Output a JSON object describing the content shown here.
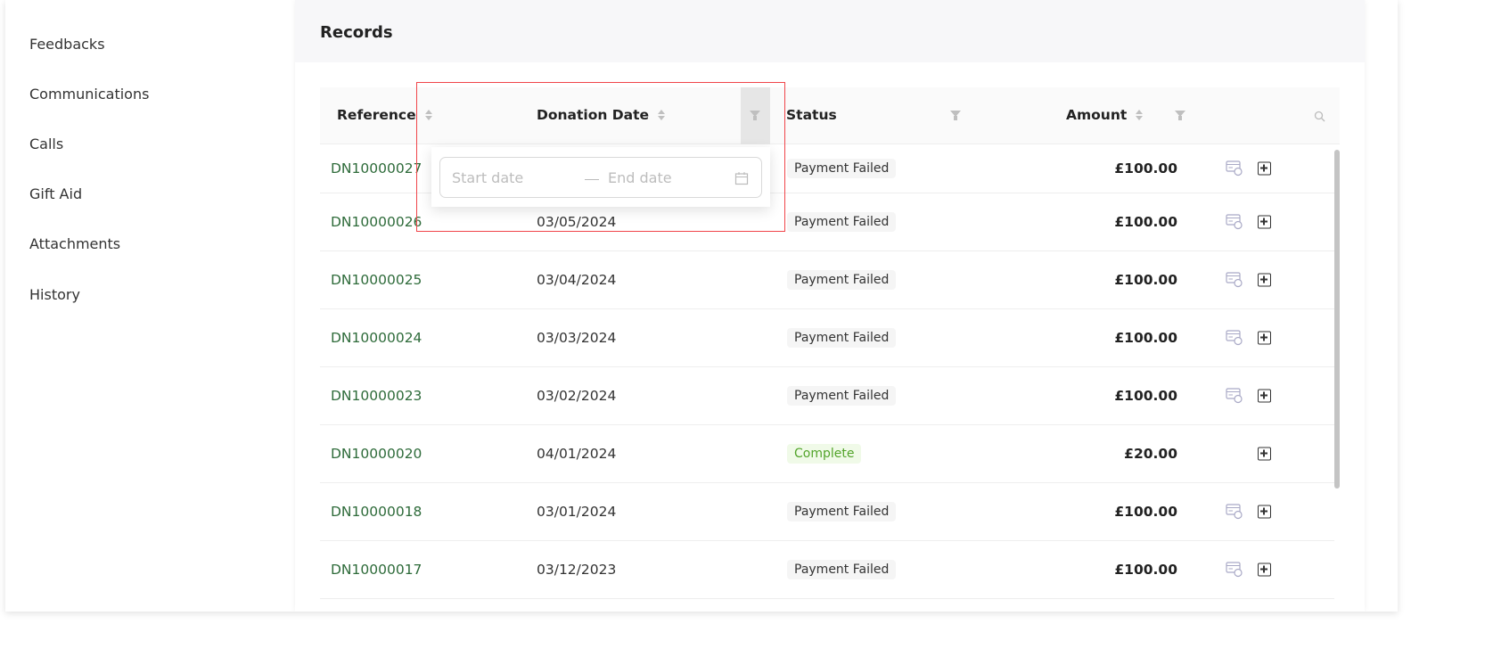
{
  "sidebar": {
    "items": [
      {
        "label": "Feedbacks"
      },
      {
        "label": "Communications"
      },
      {
        "label": "Calls"
      },
      {
        "label": "Gift Aid"
      },
      {
        "label": "Attachments"
      },
      {
        "label": "History"
      }
    ]
  },
  "main": {
    "title": "Records"
  },
  "table": {
    "columns": {
      "reference": "Reference",
      "date": "Donation Date",
      "status": "Status",
      "amount": "Amount"
    },
    "rows": [
      {
        "reference": "DN10000027",
        "date": "",
        "status": "Payment Failed",
        "amount": "£100.00",
        "retry": true
      },
      {
        "reference": "DN10000026",
        "date": "03/05/2024",
        "status": "Payment Failed",
        "amount": "£100.00",
        "retry": true
      },
      {
        "reference": "DN10000025",
        "date": "03/04/2024",
        "status": "Payment Failed",
        "amount": "£100.00",
        "retry": true
      },
      {
        "reference": "DN10000024",
        "date": "03/03/2024",
        "status": "Payment Failed",
        "amount": "£100.00",
        "retry": true
      },
      {
        "reference": "DN10000023",
        "date": "03/02/2024",
        "status": "Payment Failed",
        "amount": "£100.00",
        "retry": true
      },
      {
        "reference": "DN10000020",
        "date": "04/01/2024",
        "status": "Complete",
        "amount": "£20.00",
        "retry": false
      },
      {
        "reference": "DN10000018",
        "date": "03/01/2024",
        "status": "Payment Failed",
        "amount": "£100.00",
        "retry": true
      },
      {
        "reference": "DN10000017",
        "date": "03/12/2023",
        "status": "Payment Failed",
        "amount": "£100.00",
        "retry": true
      }
    ]
  },
  "date_filter": {
    "start_placeholder": "Start date",
    "end_placeholder": "End date"
  },
  "colors": {
    "link": "#2e6b3a",
    "complete": "#52a42a",
    "highlight": "#f0454a"
  }
}
